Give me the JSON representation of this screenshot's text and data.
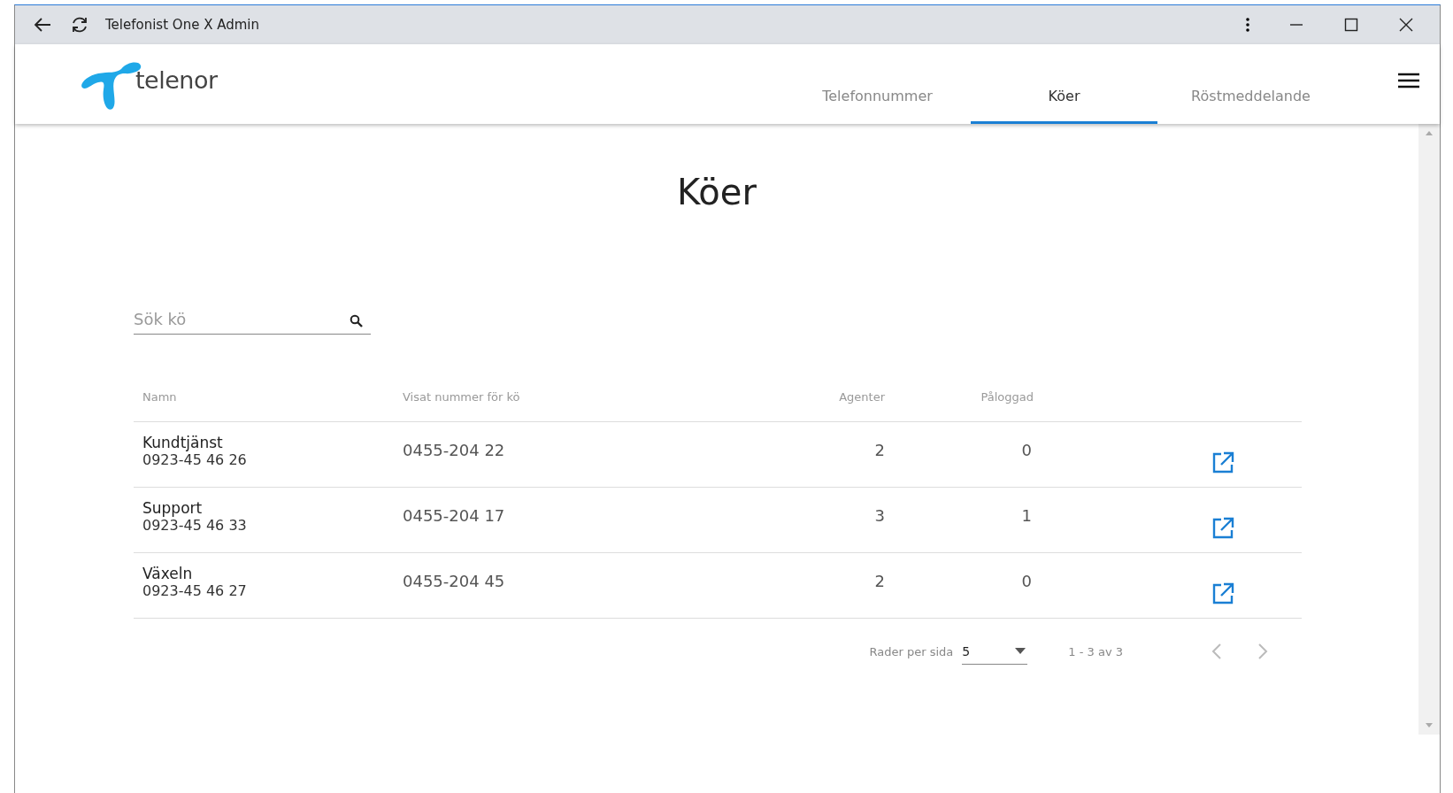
{
  "window": {
    "title": "Telefonist One X Admin"
  },
  "header": {
    "logo_text": "telenor",
    "tabs": [
      {
        "label": "Telefonnummer",
        "selected": false
      },
      {
        "label": "Köer",
        "selected": true
      },
      {
        "label": "Röstmeddelande",
        "selected": false
      }
    ]
  },
  "page_title": "Köer",
  "search": {
    "placeholder": "Sök kö"
  },
  "table": {
    "columns": [
      "Namn",
      "Visat nummer för kö",
      "Agenter",
      "Påloggad"
    ],
    "rows": [
      {
        "name": "Kundtjänst",
        "number": "0923-45 46 26",
        "shown_number": "0455-204 22",
        "agents": "2",
        "logged_in": "0"
      },
      {
        "name": "Support",
        "number": "0923-45 46 33",
        "shown_number": "0455-204 17",
        "agents": "3",
        "logged_in": "1"
      },
      {
        "name": "Växeln",
        "number": "0923-45 46 27",
        "shown_number": "0455-204 45",
        "agents": "2",
        "logged_in": "0"
      }
    ]
  },
  "pagination": {
    "rows_per_page_label": "Rader per sida",
    "rows_per_page": "5",
    "range": "1 - 3 av 3",
    "previous_disabled": true,
    "next_disabled": true
  }
}
